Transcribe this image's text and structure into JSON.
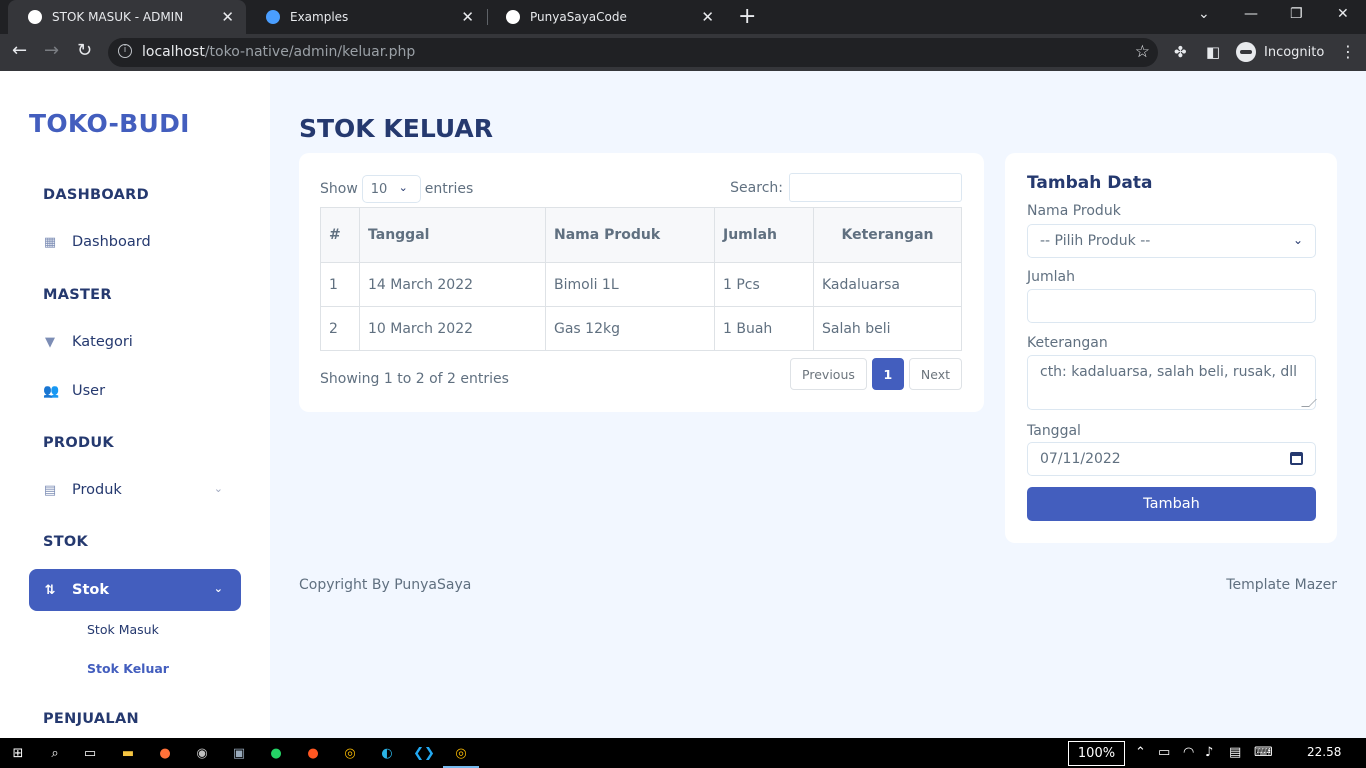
{
  "browser": {
    "tabs": [
      {
        "title": "STOK MASUK - ADMIN",
        "favicon_color": "#ffffff",
        "active": true
      },
      {
        "title": "Examples",
        "favicon_color": "#4a9eff",
        "active": false
      },
      {
        "title": "PunyaSayaCode",
        "favicon_color": "#ffffff",
        "active": false
      }
    ],
    "url_host": "localhost",
    "url_path": "/toko-native/admin/keluar.php",
    "profile_label": "Incognito"
  },
  "sidebar": {
    "brand": "TOKO-BUDI",
    "sections": {
      "dashboard": "DASHBOARD",
      "master": "MASTER",
      "produk": "PRODUK",
      "stok": "STOK",
      "penjualan": "PENJUALAN"
    },
    "items": {
      "dashboard": "Dashboard",
      "kategori": "Kategori",
      "user": "User",
      "produk": "Produk",
      "stok": "Stok"
    },
    "subitems": {
      "stok_masuk": "Stok Masuk",
      "stok_keluar": "Stok Keluar"
    }
  },
  "main": {
    "title": "STOK KELUAR",
    "table_card": {
      "show_label": "Show",
      "entries_value": "10",
      "entries_label": "entries",
      "search_label": "Search:",
      "columns": [
        "#",
        "Tanggal",
        "Nama Produk",
        "Jumlah",
        "Keterangan"
      ],
      "rows": [
        [
          "1",
          "14 March 2022",
          "Bimoli 1L",
          "1 Pcs",
          "Kadaluarsa"
        ],
        [
          "2",
          "10 March 2022",
          "Gas 12kg",
          "1 Buah",
          "Salah beli"
        ]
      ],
      "info": "Showing 1 to 2 of 2 entries",
      "pagination": {
        "previous": "Previous",
        "current": "1",
        "next": "Next"
      }
    },
    "form_card": {
      "title": "Tambah Data",
      "nama_produk_label": "Nama Produk",
      "nama_produk_value": "-- Pilih Produk --",
      "jumlah_label": "Jumlah",
      "keterangan_label": "Keterangan",
      "keterangan_placeholder": "cth: kadaluarsa, salah beli, rusak, dll",
      "tanggal_label": "Tanggal",
      "tanggal_value": "07/11/2022",
      "submit": "Tambah"
    },
    "footer": {
      "left": "Copyright By PunyaSaya",
      "right": "Template Mazer"
    }
  },
  "taskbar": {
    "zoom": "100%",
    "clock": "22.58"
  },
  "colors": {
    "primary": "#435ebe",
    "heading": "#25396f",
    "body_bg": "#f2f7ff",
    "text_muted": "#607080"
  }
}
